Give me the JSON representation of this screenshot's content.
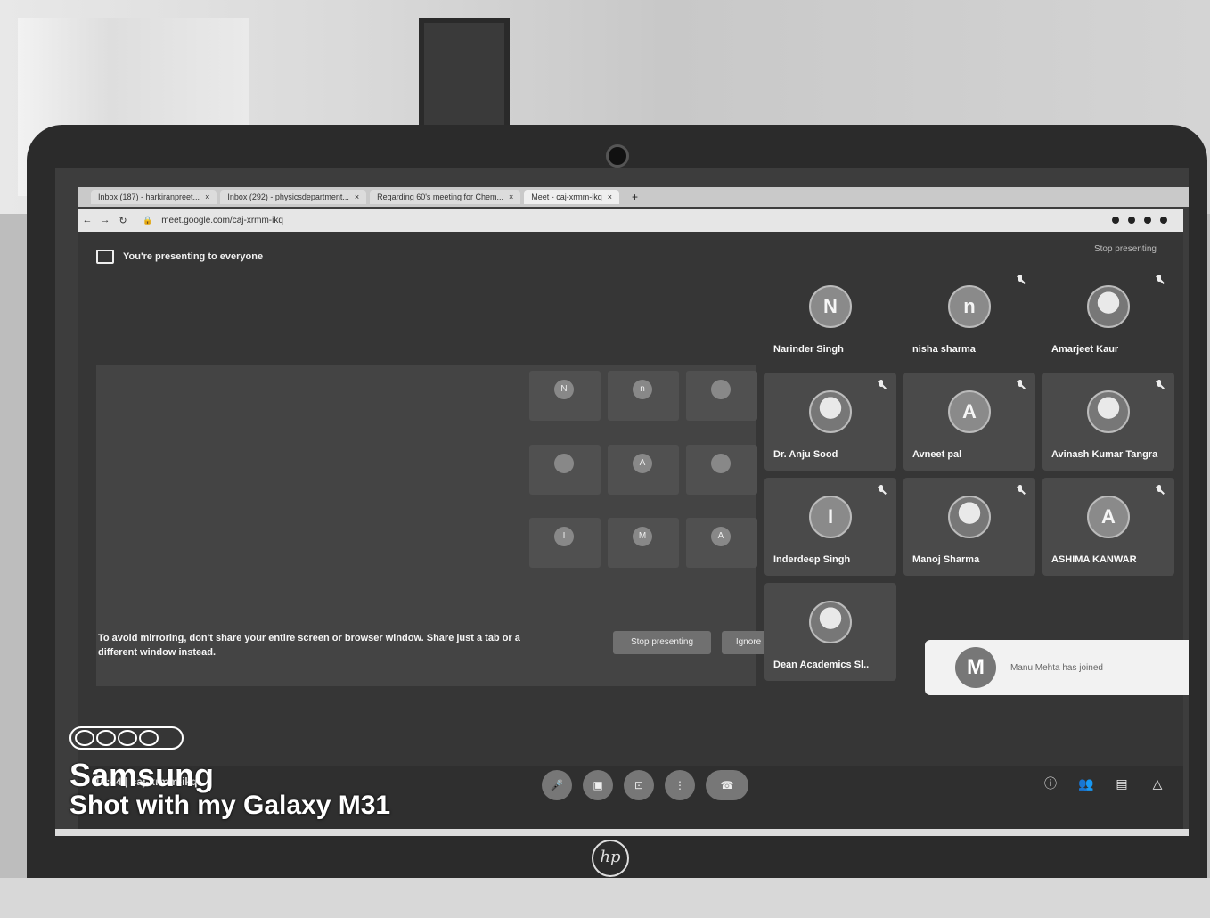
{
  "browser": {
    "tabs": [
      {
        "label": "Inbox (187) - harkiranpreet..."
      },
      {
        "label": "Inbox (292) - physicsdepartment..."
      },
      {
        "label": "Regarding 60's meeting for Chem..."
      },
      {
        "label": "Meet - caj-xrmm-ikq"
      }
    ],
    "url": "meet.google.com/caj-xrmm-ikq"
  },
  "meet": {
    "presenting_banner": "You're presenting to everyone",
    "stop_presenting": "Stop presenting",
    "mirror_warning": "To avoid mirroring, don't share your entire screen or browser window. Share just a tab or a different window instead.",
    "mirror_buttons": [
      "Stop presenting",
      "Ignore"
    ],
    "participants": [
      {
        "initial": "N",
        "name": "Narinder Singh"
      },
      {
        "initial": "n",
        "name": "nisha sharma"
      },
      {
        "initial": "",
        "name": "Amarjeet Kaur"
      },
      {
        "initial": "",
        "name": "Dr. Anju Sood"
      },
      {
        "initial": "A",
        "name": "Avneet pal"
      },
      {
        "initial": "",
        "name": "Avinash Kumar Tangra"
      },
      {
        "initial": "I",
        "name": "Inderdeep Singh"
      },
      {
        "initial": "",
        "name": "Manoj Sharma"
      },
      {
        "initial": "A",
        "name": "ASHIMA KANWAR"
      },
      {
        "initial": "",
        "name": "Dean Academics Sl.."
      }
    ],
    "join_toast": {
      "initial": "M",
      "text": "Manu Mehta has joined"
    },
    "time": "10:44",
    "meeting_code": "caj-xrmm-ikq"
  },
  "watermark": {
    "brand": "Samsung",
    "shot_with": "Shot with my Galaxy M31"
  },
  "laptop_logo": "hp"
}
